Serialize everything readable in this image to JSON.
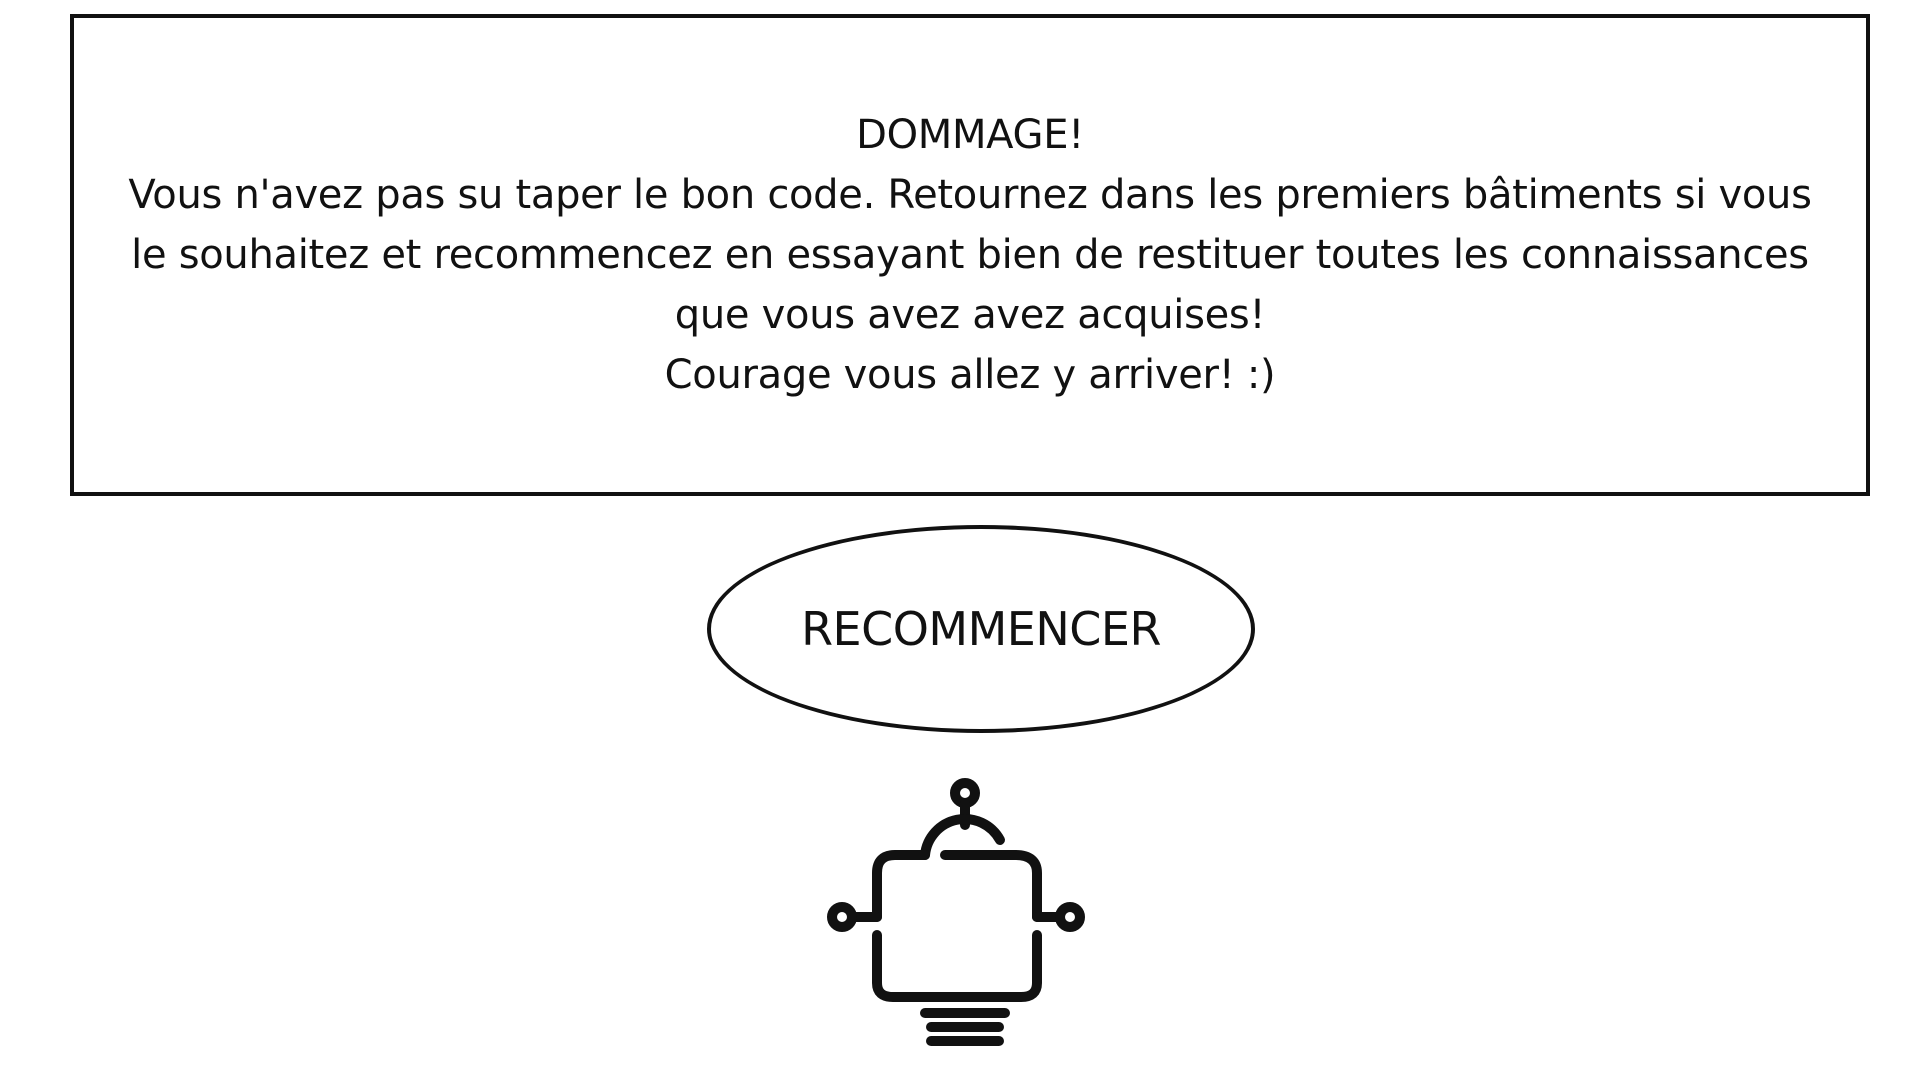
{
  "dialog": {
    "title": "DOMMAGE!",
    "lines": [
      "Vous n'avez pas su taper le bon code. Retournez dans les premiers bâtiments si vous",
      "le souhaitez et recommencez en essayant bien de restituer toutes les connaissances",
      "que vous avez avez acquises!",
      "Courage vous allez y arriver! :)"
    ]
  },
  "actions": {
    "restart_label": "RECOMMENCER"
  },
  "icons": {
    "mascot": "robot-icon"
  },
  "colors": {
    "ink": "#111111",
    "background": "#ffffff"
  }
}
